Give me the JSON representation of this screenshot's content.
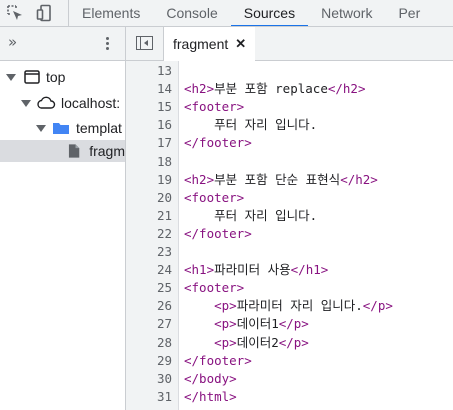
{
  "toolbar": {
    "inspect_icon": "select-element-icon",
    "device_icon": "device-toolbar-icon",
    "tabs": [
      {
        "label": "Elements"
      },
      {
        "label": "Console"
      },
      {
        "label": "Sources"
      },
      {
        "label": "Network"
      },
      {
        "label": "Per"
      }
    ],
    "active_tab": "Sources",
    "accent_color": "#1a73e8"
  },
  "navigator": {
    "more_label": "»",
    "tree": [
      {
        "label": "top",
        "icon": "window-icon"
      },
      {
        "label": "localhost:",
        "icon": "cloud-icon"
      },
      {
        "label": "templat",
        "icon": "folder-icon"
      },
      {
        "label": "fragm",
        "icon": "file-icon"
      }
    ]
  },
  "editor": {
    "file_tab": {
      "label": "fragment",
      "close": "✕"
    },
    "lines": [
      {
        "num": "13",
        "parts": []
      },
      {
        "num": "14",
        "parts": [
          {
            "t": "<h2>",
            "c": "tag"
          },
          {
            "t": "부분 포함 replace",
            "c": "text"
          },
          {
            "t": "</h2>",
            "c": "tag"
          }
        ]
      },
      {
        "num": "15",
        "parts": [
          {
            "t": "<footer>",
            "c": "tag"
          }
        ]
      },
      {
        "num": "16",
        "parts": [
          {
            "t": "    푸터 자리 입니다.",
            "c": "text"
          }
        ]
      },
      {
        "num": "17",
        "parts": [
          {
            "t": "</footer>",
            "c": "tag"
          }
        ]
      },
      {
        "num": "18",
        "parts": []
      },
      {
        "num": "19",
        "parts": [
          {
            "t": "<h2>",
            "c": "tag"
          },
          {
            "t": "부분 포함 단순 표현식",
            "c": "text"
          },
          {
            "t": "</h2>",
            "c": "tag"
          }
        ]
      },
      {
        "num": "20",
        "parts": [
          {
            "t": "<footer>",
            "c": "tag"
          }
        ]
      },
      {
        "num": "21",
        "parts": [
          {
            "t": "    푸터 자리 입니다.",
            "c": "text"
          }
        ]
      },
      {
        "num": "22",
        "parts": [
          {
            "t": "</footer>",
            "c": "tag"
          }
        ]
      },
      {
        "num": "23",
        "parts": []
      },
      {
        "num": "24",
        "parts": [
          {
            "t": "<h1>",
            "c": "tag"
          },
          {
            "t": "파라미터 사용",
            "c": "text"
          },
          {
            "t": "</h1>",
            "c": "tag"
          }
        ]
      },
      {
        "num": "25",
        "parts": [
          {
            "t": "<footer>",
            "c": "tag"
          }
        ]
      },
      {
        "num": "26",
        "parts": [
          {
            "t": "    ",
            "c": "text"
          },
          {
            "t": "<p>",
            "c": "tag"
          },
          {
            "t": "파라미터 자리 입니다.",
            "c": "text"
          },
          {
            "t": "</p>",
            "c": "tag"
          }
        ]
      },
      {
        "num": "27",
        "parts": [
          {
            "t": "    ",
            "c": "text"
          },
          {
            "t": "<p>",
            "c": "tag"
          },
          {
            "t": "데이터1",
            "c": "text"
          },
          {
            "t": "</p>",
            "c": "tag"
          }
        ]
      },
      {
        "num": "28",
        "parts": [
          {
            "t": "    ",
            "c": "text"
          },
          {
            "t": "<p>",
            "c": "tag"
          },
          {
            "t": "데이터2",
            "c": "text"
          },
          {
            "t": "</p>",
            "c": "tag"
          }
        ]
      },
      {
        "num": "29",
        "parts": [
          {
            "t": "</footer>",
            "c": "tag"
          }
        ]
      },
      {
        "num": "30",
        "parts": [
          {
            "t": "</body>",
            "c": "tag"
          }
        ]
      },
      {
        "num": "31",
        "parts": [
          {
            "t": "</html>",
            "c": "tag"
          }
        ]
      }
    ]
  }
}
